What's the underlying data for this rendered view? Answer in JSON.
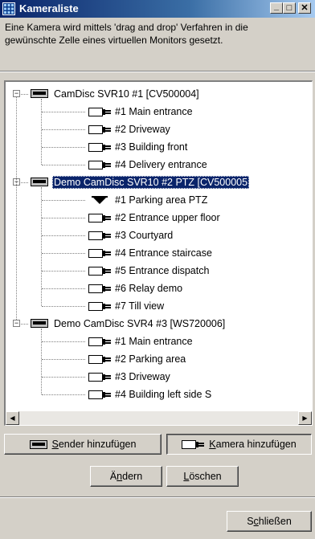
{
  "window": {
    "title": "Kameraliste",
    "minimize_glyph": "_",
    "maximize_glyph": "□",
    "close_glyph": "✕"
  },
  "description": {
    "line1": "Eine Kamera wird mittels 'drag and drop' Verfahren in die",
    "line2": "gewünschte Zelle eines virtuellen Monitors gesetzt."
  },
  "tree": {
    "senders": [
      {
        "label": "CamDisc SVR10 #1 [CV500004]",
        "selected": false,
        "cameras": [
          {
            "label": "#1  Main entrance",
            "type": "box"
          },
          {
            "label": "#2  Driveway",
            "type": "box"
          },
          {
            "label": "#3  Building front",
            "type": "box"
          },
          {
            "label": "#4  Delivery entrance",
            "type": "box"
          }
        ]
      },
      {
        "label": "Demo CamDisc SVR10 #2 PTZ [CV500005",
        "selected": true,
        "cameras": [
          {
            "label": "#1  Parking area PTZ",
            "type": "dome"
          },
          {
            "label": "#2  Entrance upper floor",
            "type": "box"
          },
          {
            "label": "#3  Courtyard",
            "type": "box"
          },
          {
            "label": "#4  Entrance staircase",
            "type": "box"
          },
          {
            "label": "#5  Entrance dispatch",
            "type": "box"
          },
          {
            "label": "#6  Relay demo",
            "type": "box"
          },
          {
            "label": "#7  Till view",
            "type": "box"
          }
        ]
      },
      {
        "label": "Demo CamDisc SVR4 #3 [WS720006]",
        "selected": false,
        "cameras": [
          {
            "label": "#1  Main entrance",
            "type": "box"
          },
          {
            "label": "#2  Parking area",
            "type": "box"
          },
          {
            "label": "#3  Driveway",
            "type": "box"
          },
          {
            "label": "#4  Building left side S",
            "type": "box"
          }
        ]
      }
    ],
    "expand_glyph": "−"
  },
  "scrollbar": {
    "left_arrow": "◀",
    "right_arrow": "▶"
  },
  "buttons": {
    "add_sender": {
      "pre": "",
      "accel": "S",
      "post": "ender hinzufügen"
    },
    "add_camera": {
      "pre": "",
      "accel": "K",
      "post": "amera hinzufügen"
    },
    "edit": {
      "pre": "Ä",
      "accel": "n",
      "post": "dern"
    },
    "delete": {
      "pre": "",
      "accel": "L",
      "post": "öschen"
    },
    "close": {
      "pre": "S",
      "accel": "c",
      "post": "hließen"
    }
  },
  "colors": {
    "face": "#d4d0c8",
    "selection": "#0a246a",
    "title_start": "#0a246a",
    "title_end": "#a6caf0"
  }
}
